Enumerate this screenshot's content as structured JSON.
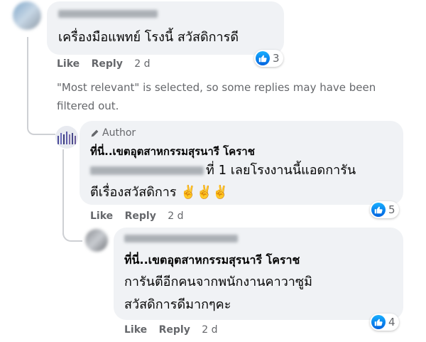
{
  "comment1": {
    "text": "เครื่องมือแพทย์ โรงนี้ สวัสดิการดี",
    "reactions": "3",
    "actions": {
      "like": "Like",
      "reply": "Reply",
      "time": "2 d"
    }
  },
  "notice": "\"Most relevant\" is selected, so some replies may have been filtered out.",
  "reply1": {
    "author_badge": "Author",
    "name": "ที่นี่..เขตอุตสาหกรรมสุรนารี โคราช",
    "text_line1": "ที่ 1 เลยโรงงานนี้แอดการัน",
    "text_line2": "ตีเรื่องสวัสดิการ ✌️✌️✌️",
    "reactions": "5",
    "actions": {
      "like": "Like",
      "reply": "Reply",
      "time": "2 d"
    }
  },
  "reply2": {
    "name": "ที่นี่..เขตอุตสาหกรรมสุรนารี โคราช",
    "text_line1": "การันตีอีกคนจากพนักงานคาวาซูมิ",
    "text_line2": "สวัสดิการดีมากๆคะ",
    "reactions": "4",
    "actions": {
      "like": "Like",
      "reply": "Reply",
      "time": "2 d"
    }
  },
  "colors": {
    "bubble": "#f0f2f5",
    "like_blue": "#1877f2",
    "meta_gray": "#65676b"
  },
  "icons": [
    "like-icon",
    "pencil-icon"
  ]
}
